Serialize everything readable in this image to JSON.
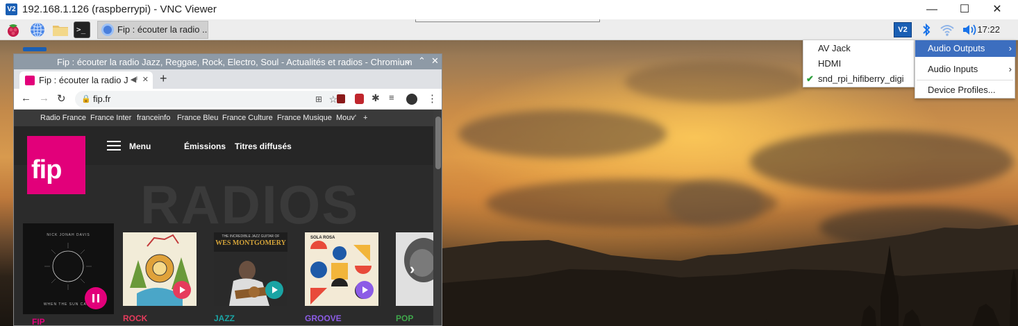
{
  "vnc": {
    "title": "192.168.1.126 (raspberrypi) - VNC Viewer",
    "logo": "V2",
    "minimize": "—",
    "maximize": "☐",
    "close": "✕"
  },
  "taskbar": {
    "task_label": "Fip : écouter la radio ...",
    "clock": "17:22",
    "vnc_tray_logo": "V2",
    "icons": [
      "raspberry-menu-icon",
      "globe-browser-icon",
      "folder-icon",
      "terminal-icon",
      "vnc-tray-icon",
      "bluetooth-icon",
      "wifi-icon",
      "volume-icon"
    ],
    "terminal_glyph": ">_"
  },
  "chromium": {
    "window_title": "Fip : écouter la radio Jazz, Reggae, Rock, Electro, Soul - Actualités et radios - Chromium",
    "tab_title": "Fip : écouter la radio J",
    "url": "fip.fr",
    "new_tab": "+",
    "tab_close": "✕",
    "title_controls": {
      "minimize": "⌄",
      "maximize": "⌃",
      "close": "✕"
    }
  },
  "site": {
    "network_links": [
      "Radio France",
      "France Inter",
      "franceinfo",
      "France Bleu",
      "France Culture",
      "France Musique",
      "Mouv'",
      "+"
    ],
    "logo": "fip",
    "menu_label": "Menu",
    "nav": [
      "Émissions",
      "Titres diffusés"
    ],
    "background_heading": "RADIOS",
    "stations": [
      {
        "name": "FIP",
        "color": "#e2007a"
      },
      {
        "name": "ROCK",
        "color": "#e63b5c"
      },
      {
        "name": "JAZZ",
        "color": "#1aa4a4"
      },
      {
        "name": "GROOVE",
        "color": "#8c5ce6"
      },
      {
        "name": "POP",
        "color": "#3fa64b"
      }
    ],
    "album_text": {
      "fip_top": "NICK JONAH DAVIS",
      "fip_bottom": "WHEN THE SUN CAME",
      "jazz_top": "THE INCREDIBLE JAZZ GUITAR OF",
      "jazz_name": "WES MONTGOMERY",
      "groove_top": "SOLA ROSA"
    }
  },
  "audio_menu": {
    "items": [
      {
        "label": "Audio Outputs",
        "arrow": "›",
        "highlighted": true
      },
      {
        "label": "Audio Inputs",
        "arrow": "›",
        "highlighted": false
      },
      {
        "label": "Device Profiles...",
        "arrow": "",
        "highlighted": false
      }
    ],
    "outputs": [
      {
        "label": "AV Jack",
        "checked": false
      },
      {
        "label": "HDMI",
        "checked": false
      },
      {
        "label": "snd_rpi_hifiberry_digi",
        "checked": true
      }
    ],
    "check_glyph": "✔"
  }
}
